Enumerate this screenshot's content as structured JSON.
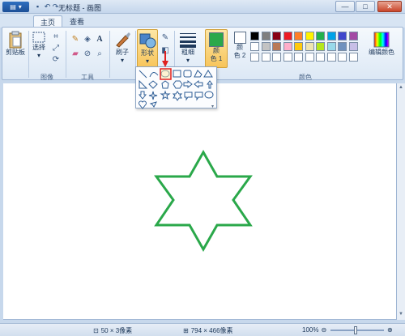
{
  "window": {
    "title": "无标题 - 画图",
    "minimize": "—",
    "maximize": "□",
    "close": "✕"
  },
  "tabs": [
    {
      "label": "主页",
      "active": true
    },
    {
      "label": "查看",
      "active": false
    }
  ],
  "ribbon": {
    "clipboard": {
      "paste_label": "剪贴板",
      "group": ""
    },
    "image": {
      "select_label": "选择",
      "group": "图像"
    },
    "tools": {
      "group": "工具"
    },
    "brushes": {
      "label": "刷子"
    },
    "shapes": {
      "label": "形状"
    },
    "size": {
      "label": "粗细"
    },
    "color1": {
      "label_1": "颜",
      "label_2": "色 1",
      "value": "#2aa84a"
    },
    "color2": {
      "label_1": "颜",
      "label_2": "色 2",
      "value": "#ffffff"
    },
    "colors_group": "颜色",
    "edit_colors": "编辑颜色",
    "palette_row1": [
      "#000000",
      "#7f7f7f",
      "#880015",
      "#ed1c24",
      "#ff7f27",
      "#fff200",
      "#22b14c",
      "#00a2e8",
      "#3f48cc",
      "#a349a4"
    ],
    "palette_row2": [
      "#ffffff",
      "#c3c3c3",
      "#b97a57",
      "#ffaec9",
      "#ffc90e",
      "#efe4b0",
      "#b5e61d",
      "#99d9ea",
      "#7092be",
      "#c8bfe7"
    ],
    "palette_row3": [
      "#ffffff",
      "#ffffff",
      "#ffffff",
      "#ffffff",
      "#ffffff",
      "#ffffff",
      "#ffffff",
      "#ffffff",
      "#ffffff",
      "#ffffff"
    ]
  },
  "canvas": {
    "star_color": "#2aa84a"
  },
  "status": {
    "selection_size": "50 × 3像素",
    "canvas_size": "794 × 466像素",
    "zoom": "100%"
  }
}
